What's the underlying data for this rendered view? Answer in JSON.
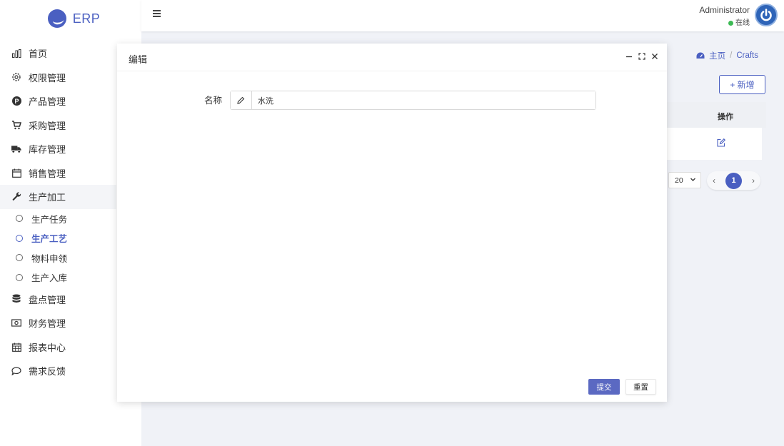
{
  "app": {
    "logo_text": "ERP",
    "brand_color": "#4a5fc1"
  },
  "sidebar": {
    "items": [
      {
        "label": "首页",
        "icon": "bar-chart-icon"
      },
      {
        "label": "权限管理",
        "icon": "gear-icon"
      },
      {
        "label": "产品管理",
        "icon": "p-circle-icon"
      },
      {
        "label": "采购管理",
        "icon": "cart-icon"
      },
      {
        "label": "库存管理",
        "icon": "truck-icon"
      },
      {
        "label": "销售管理",
        "icon": "calendar-icon"
      },
      {
        "label": "生产加工",
        "icon": "wrench-icon",
        "expanded": true
      },
      {
        "label": "盘点管理",
        "icon": "database-icon"
      },
      {
        "label": "财务管理",
        "icon": "money-icon"
      },
      {
        "label": "报表中心",
        "icon": "calendar-grid-icon"
      },
      {
        "label": "需求反馈",
        "icon": "comment-icon"
      }
    ],
    "subitems": [
      {
        "label": "生产任务",
        "active": false
      },
      {
        "label": "生产工艺",
        "active": true
      },
      {
        "label": "物料申领",
        "active": false
      },
      {
        "label": "生产入库",
        "active": false
      }
    ]
  },
  "topbar": {
    "username": "Administrator",
    "status": "在线",
    "status_color": "#3cba54"
  },
  "breadcrumb": {
    "home": "主页",
    "current": "Crafts"
  },
  "content": {
    "add_button": "+ 新增",
    "table": {
      "action_header": "操作"
    },
    "pagination": {
      "page_size": "20",
      "current_page": "1"
    }
  },
  "modal": {
    "title": "编辑",
    "form": {
      "name_label": "名称",
      "name_value": "水洗"
    },
    "submit_label": "提交",
    "reset_label": "重置"
  }
}
